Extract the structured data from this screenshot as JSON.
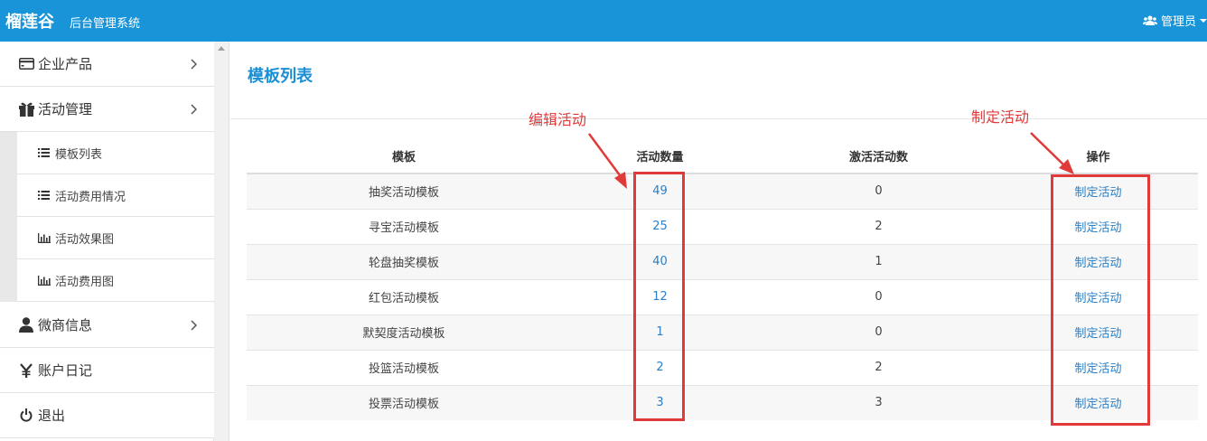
{
  "header": {
    "brand": "榴莲谷",
    "subtitle": "后台管理系统",
    "admin_label": "管理员"
  },
  "sidebar": {
    "items": [
      {
        "label": "企业产品",
        "icon": "credit-card-icon"
      },
      {
        "label": "活动管理",
        "icon": "gift-icon"
      },
      {
        "label": "微商信息",
        "icon": "user-icon"
      },
      {
        "label": "账户日记",
        "icon": "yen-icon"
      },
      {
        "label": "退出",
        "icon": "power-icon"
      }
    ],
    "sub_items": [
      {
        "label": "模板列表",
        "icon": "list-icon"
      },
      {
        "label": "活动费用情况",
        "icon": "list-icon"
      },
      {
        "label": "活动效果图",
        "icon": "bar-chart-icon"
      },
      {
        "label": "活动费用图",
        "icon": "bar-chart-icon"
      }
    ]
  },
  "main": {
    "title": "模板列表",
    "table": {
      "headers": [
        "模板",
        "活动数量",
        "激活活动数",
        "操作"
      ],
      "rows": [
        {
          "name": "抽奖活动模板",
          "count": "49",
          "active": "0",
          "action": "制定活动"
        },
        {
          "name": "寻宝活动模板",
          "count": "25",
          "active": "2",
          "action": "制定活动"
        },
        {
          "name": "轮盘抽奖模板",
          "count": "40",
          "active": "1",
          "action": "制定活动"
        },
        {
          "name": "红包活动模板",
          "count": "12",
          "active": "0",
          "action": "制定活动"
        },
        {
          "name": "默契度活动模板",
          "count": "1",
          "active": "0",
          "action": "制定活动"
        },
        {
          "name": "投篮活动模板",
          "count": "2",
          "active": "2",
          "action": "制定活动"
        },
        {
          "name": "投票活动模板",
          "count": "3",
          "active": "3",
          "action": "制定活动"
        }
      ]
    }
  },
  "annotations": {
    "edit_label": "编辑活动",
    "create_label": "制定活动",
    "color": "#e03a3a"
  },
  "colors": {
    "header_bg": "#1a94d8",
    "title": "#1a8fd6",
    "link": "#2a7fc7"
  }
}
